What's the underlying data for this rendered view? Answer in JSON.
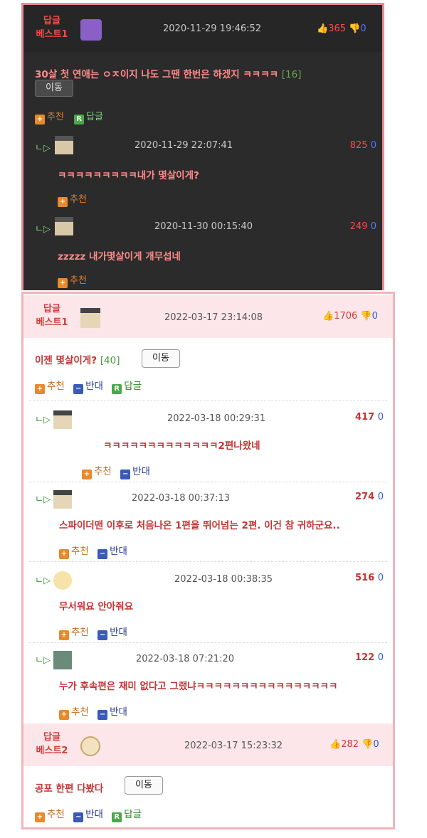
{
  "dark": {
    "best_label": [
      "답글",
      "베스트1"
    ],
    "date": "2020-11-29 19:46:52",
    "score_up": "365",
    "score_down": "0",
    "text": "30살 첫 연애는 ㅇㅈ이지 나도 그땐 한번은 하겠지 ㅋㅋㅋㅋ",
    "count": "[16]",
    "move": "이동",
    "recommend": "추천",
    "reply": "답글",
    "replies": [
      {
        "date": "2020-11-29 22:07:41",
        "up": "825",
        "down": "0",
        "text": "ㅋㅋㅋㅋㅋㅋㅋㅋㅋ내가 몇살이게?",
        "recommend": "추천"
      },
      {
        "date": "2020-11-30 00:15:40",
        "up": "249",
        "down": "0",
        "text": "zzzzz 내가몇살이게 개무섭네",
        "recommend": "추천"
      }
    ]
  },
  "light": {
    "best1": {
      "label": [
        "답글",
        "베스트1"
      ],
      "date": "2022-03-17 23:14:08",
      "up": "1706",
      "down": "0",
      "text": "이젠 몇살이게?",
      "count": "[40]",
      "move": "이동"
    },
    "actions": {
      "recommend": "추천",
      "oppose": "반대",
      "reply": "답글"
    },
    "replies": [
      {
        "date": "2022-03-18 00:29:31",
        "up": "417",
        "down": "0",
        "text": "ㅋㅋㅋㅋㅋㅋㅋㅋㅋㅋㅋㅋㅋ2편나왔네"
      },
      {
        "date": "2022-03-18 00:37:13",
        "up": "274",
        "down": "0",
        "text": "스파이더맨 이후로 처음나온 1편을 뛰어넘는 2편. 이건 참 귀하군요.."
      },
      {
        "date": "2022-03-18 00:38:35",
        "up": "516",
        "down": "0",
        "text": "무서워요 안아줘요"
      },
      {
        "date": "2022-03-18 07:21:20",
        "up": "122",
        "down": "0",
        "text": "누가 후속편은 재미 없다고 그랬냐ㅋㅋㅋㅋㅋㅋㅋㅋㅋㅋㅋㅋㅋㅋㅋㅋ"
      }
    ],
    "best2": {
      "label": [
        "답글",
        "베스트2"
      ],
      "date": "2022-03-17 15:23:32",
      "up": "282",
      "down": "0",
      "text": "공포 한편 다봤다",
      "move": "이동"
    }
  },
  "icons": {
    "thumbs_up": "thumbs-up-icon",
    "thumbs_down": "thumbs-down-icon",
    "reply_arrow": "reply-arrow-icon",
    "recommend_badge": "plus-icon",
    "oppose_badge": "minus-icon",
    "reply_badge": "r-icon"
  }
}
